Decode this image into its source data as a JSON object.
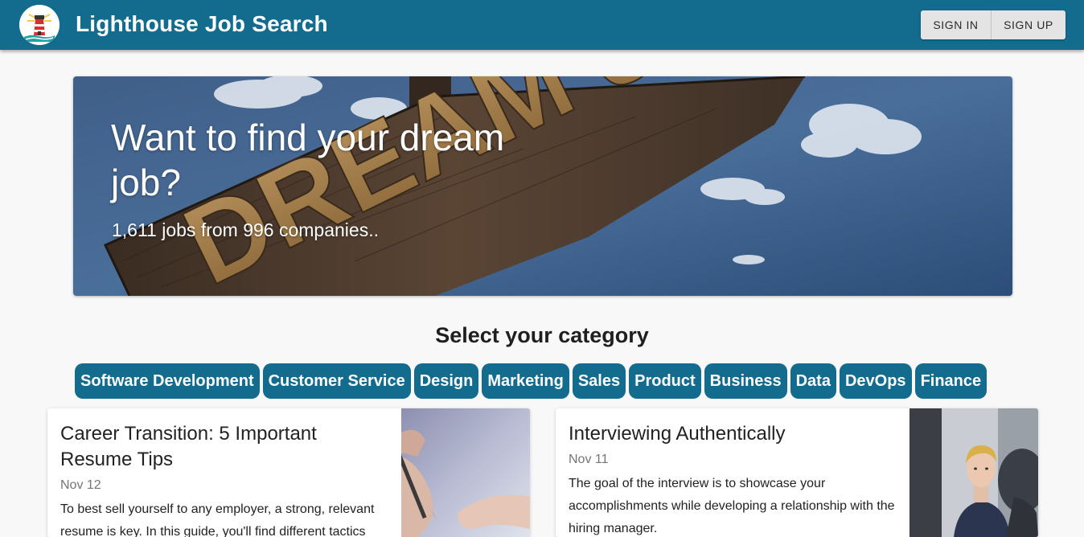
{
  "header": {
    "title": "Lighthouse Job Search",
    "logo_icon": "lighthouse-icon",
    "sign_in_label": "SIGN IN",
    "sign_up_label": "SIGN UP",
    "bar_color": "#136b8e"
  },
  "hero": {
    "heading": "Want to find your dream job?",
    "subheading": "1,611 jobs from 996 companies..",
    "sign_text": "DREAM JOB"
  },
  "categories": {
    "heading": "Select your category",
    "items": [
      "Software Development",
      "Customer Service",
      "Design",
      "Marketing",
      "Sales",
      "Product",
      "Business",
      "Data",
      "DevOps",
      "Finance"
    ]
  },
  "articles": [
    {
      "title": "Career Transition: 5 Important Resume Tips",
      "date": "Nov 12",
      "excerpt": "To best sell yourself to any employer, a strong, relevant resume is key. In this guide, you'll find different tactics",
      "image_icon": "pen-writing-icon"
    },
    {
      "title": "Interviewing Authentically",
      "date": "Nov 11",
      "excerpt": "The goal of the interview is to showcase your accomplishments while developing a relationship with the hiring manager.",
      "image_icon": "interview-photo-icon"
    }
  ]
}
